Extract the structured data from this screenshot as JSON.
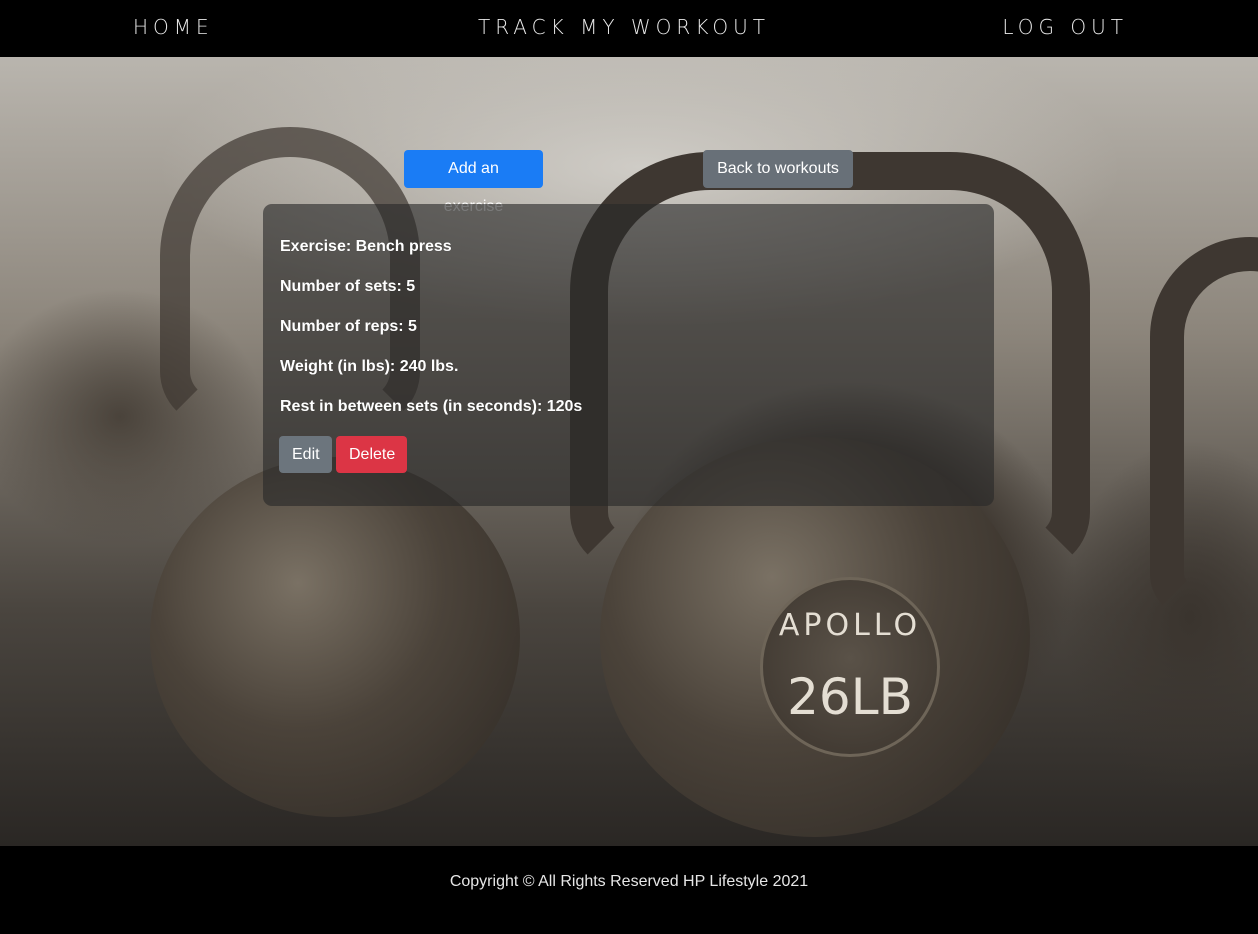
{
  "nav": {
    "home": "HOME",
    "title": "TRACK MY WORKOUT",
    "logout": "LOG OUT"
  },
  "actions": {
    "add_exercise": "Add an exercise",
    "back_to_workouts": "Back to workouts"
  },
  "exercise": {
    "name_line": "Exercise: Bench press",
    "sets_line": "Number of sets: 5",
    "reps_line": "Number of reps: 5",
    "weight_line": "Weight (in lbs): 240 lbs.",
    "rest_line": "Rest in between sets (in seconds): 120s",
    "edit_label": "Edit",
    "delete_label": "Delete"
  },
  "hero_image": {
    "badge_brand": "APOLLO",
    "badge_weight": "26LB"
  },
  "footer": {
    "copyright": "Copyright © All Rights Reserved HP Lifestyle 2021"
  },
  "colors": {
    "primary": "#1a7cf5",
    "secondary": "#6c757d",
    "danger": "#dc3545",
    "nav_bg": "#000000"
  }
}
